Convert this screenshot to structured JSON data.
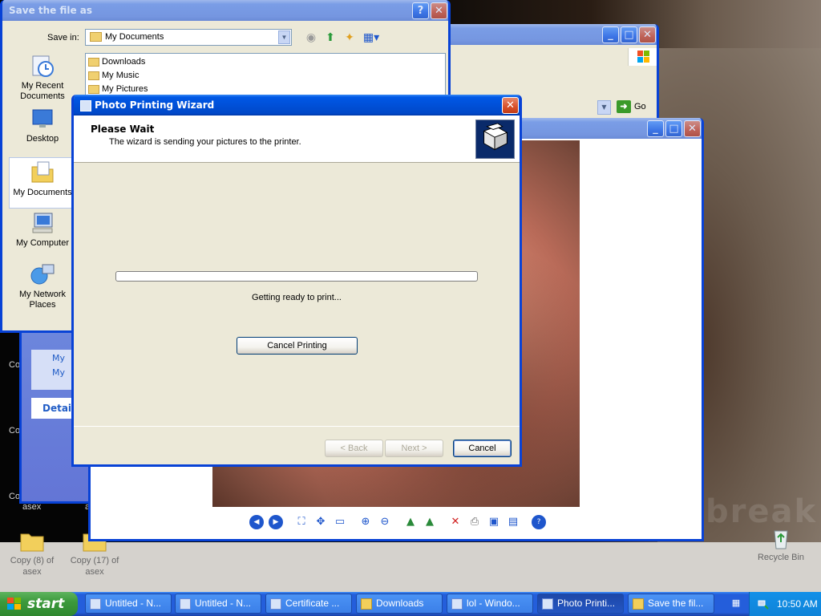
{
  "explorer": {
    "go_label": "Go",
    "details_label": "Details",
    "side_labels": [
      "My",
      "My"
    ]
  },
  "save_dialog": {
    "title": "Save the file as",
    "save_in_label": "Save in:",
    "save_in_value": "My Documents",
    "places": [
      {
        "label": "My Recent Documents",
        "icon": "recent-documents-icon"
      },
      {
        "label": "Desktop",
        "icon": "desktop-icon"
      },
      {
        "label": "My Documents",
        "icon": "my-documents-icon"
      },
      {
        "label": "My Computer",
        "icon": "my-computer-icon"
      },
      {
        "label": "My Network Places",
        "icon": "network-places-icon"
      }
    ],
    "files": [
      "Downloads",
      "My Music",
      "My Pictures"
    ],
    "help_btn": "?",
    "close_btn": "✕"
  },
  "wizard": {
    "title": "Photo Printing Wizard",
    "heading": "Please Wait",
    "subheading": "The wizard is sending your pictures to the printer.",
    "progress": 0.0,
    "status": "Getting ready to print...",
    "cancel_printing": "Cancel Printing",
    "back": "< Back",
    "next": "Next >",
    "cancel": "Cancel",
    "close_btn": "✕"
  },
  "desktop": {
    "icons": [
      {
        "label": "Copy (8) of asex"
      },
      {
        "label": "Copy (17) of asex"
      },
      {
        "label": "Recycle Bin"
      }
    ],
    "edge_texts": [
      "Co",
      "Co",
      "Co",
      "asex",
      "a"
    ]
  },
  "taskbar": {
    "start": "start",
    "items": [
      "Untitled - N...",
      "Untitled - N...",
      "Certificate ...",
      "Downloads",
      "lol - Windo...",
      "Photo Printi...",
      "Save the fil..."
    ],
    "active_index": 5,
    "clock": "10:50 AM"
  },
  "colors": {
    "title_active": "#0054e3",
    "dialog_bg": "#ece9d8",
    "taskbar": "#245edb",
    "start_green": "#3c9a3c"
  }
}
